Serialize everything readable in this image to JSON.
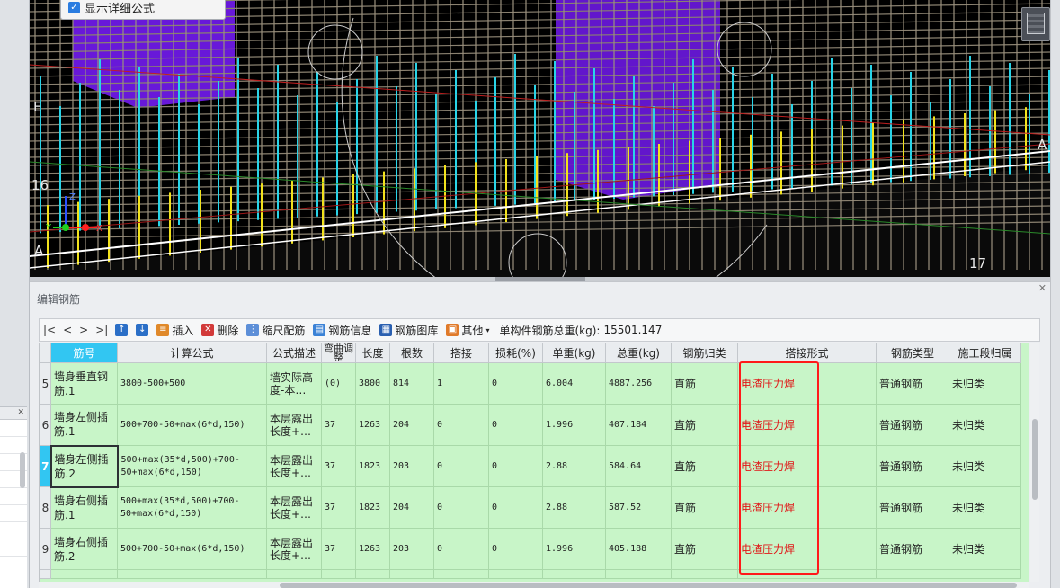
{
  "popup": {
    "checkbox_label": "显示详细公式",
    "checked": true
  },
  "viewport": {
    "labels": {
      "axis_e": "E",
      "axis_16": "16",
      "axis_a_left": "A",
      "axis_a_right": "A",
      "axis_17": "17"
    },
    "axis_gizmo": {
      "x": "X",
      "y": "Y",
      "z": "Z"
    }
  },
  "panel": {
    "title": "编辑钢筋"
  },
  "toolbar": {
    "nav_first": "|<",
    "nav_prev": "<",
    "nav_next": ">",
    "nav_last": ">|",
    "insert": "插入",
    "delete": "删除",
    "scale": "缩尺配筋",
    "rebar_info": "钢筋信息",
    "rebar_library": "钢筋图库",
    "other": "其他",
    "total_label": "单构件钢筋总重(kg):",
    "total_value": "15501.147"
  },
  "table": {
    "headers": [
      "",
      "筋号",
      "计算公式",
      "公式描述",
      "弯曲调整",
      "长度",
      "根数",
      "搭接",
      "损耗(%)",
      "单重(kg)",
      "总重(kg)",
      "钢筋归类",
      "搭接形式",
      "钢筋类型",
      "施工段归属"
    ],
    "rows": [
      {
        "num": "5",
        "name": "墙身垂直钢筋.1",
        "formula": "3800-500+500",
        "desc": "墙实际高度-本…",
        "bend": "(0)",
        "length": "3800",
        "count": "814",
        "lap": "1",
        "loss": "0",
        "unit_weight": "6.004",
        "total_weight": "4887.256",
        "category": "直筋",
        "lap_form": "电渣压力焊",
        "type": "普通钢筋",
        "segment": "未归类"
      },
      {
        "num": "6",
        "name": "墙身左侧插筋.1",
        "formula": "500+700-50+max(6*d,150)",
        "desc": "本层露出长度+…",
        "bend": "37",
        "length": "1263",
        "count": "204",
        "lap": "0",
        "loss": "0",
        "unit_weight": "1.996",
        "total_weight": "407.184",
        "category": "直筋",
        "lap_form": "电渣压力焊",
        "type": "普通钢筋",
        "segment": "未归类"
      },
      {
        "num": "7",
        "name": "墙身左侧插筋.2",
        "formula": "500+max(35*d,500)+700-50+max(6*d,150)",
        "desc": "本层露出长度+…",
        "bend": "37",
        "length": "1823",
        "count": "203",
        "lap": "0",
        "loss": "0",
        "unit_weight": "2.88",
        "total_weight": "584.64",
        "category": "直筋",
        "lap_form": "电渣压力焊",
        "type": "普通钢筋",
        "segment": "未归类"
      },
      {
        "num": "8",
        "name": "墙身右侧插筋.1",
        "formula": "500+max(35*d,500)+700-50+max(6*d,150)",
        "desc": "本层露出长度+…",
        "bend": "37",
        "length": "1823",
        "count": "204",
        "lap": "0",
        "loss": "0",
        "unit_weight": "2.88",
        "total_weight": "587.52",
        "category": "直筋",
        "lap_form": "电渣压力焊",
        "type": "普通钢筋",
        "segment": "未归类"
      },
      {
        "num": "9",
        "name": "墙身右侧插筋.2",
        "formula": "500+700-50+max(6*d,150)",
        "desc": "本层露出长度+…",
        "bend": "37",
        "length": "1263",
        "count": "203",
        "lap": "0",
        "loss": "0",
        "unit_weight": "1.996",
        "total_weight": "405.188",
        "category": "直筋",
        "lap_form": "电渣压力焊",
        "type": "普通钢筋",
        "segment": "未归类"
      }
    ],
    "selected_row_num": "7"
  },
  "colors": {
    "header_highlight": "#32c6f2",
    "row_bg": "#c8f5c8",
    "weld_text": "#e01818",
    "highlight_box": "#ff1a1a",
    "rebar_cyan": "#29d4e8",
    "rebar_yellow": "#f2e21c",
    "wall_purple": "#7a1cff"
  }
}
